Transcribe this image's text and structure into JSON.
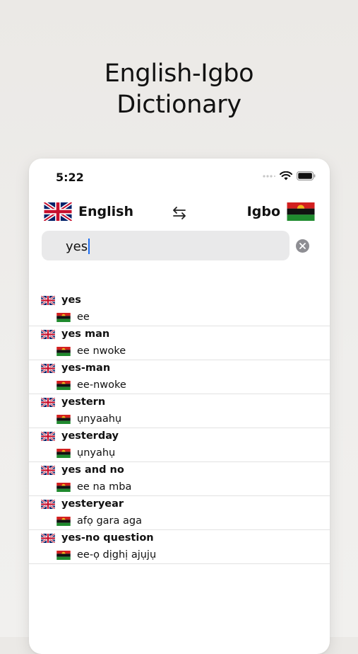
{
  "headline": {
    "line1": "English-Igbo",
    "line2": "Dictionary"
  },
  "status_bar": {
    "time": "5:22"
  },
  "languages": {
    "source": "English",
    "target": "Igbo"
  },
  "icons": {
    "swap": "swap-arrows-icon",
    "clear": "clear-circle-icon",
    "wifi": "wifi-icon",
    "battery": "battery-icon",
    "signal": "signal-dots-icon"
  },
  "search": {
    "value": "yes"
  },
  "colors": {
    "accent_caret": "#1a6cf0",
    "biafra_red": "#d21f1f",
    "biafra_black": "#111111",
    "biafra_green": "#1f8a2e",
    "biafra_sun": "#f1b51a"
  },
  "results": [
    {
      "en": "yes",
      "ig": "ee"
    },
    {
      "en": "yes man",
      "ig": "ee nwoke"
    },
    {
      "en": "yes-man",
      "ig": "ee-nwoke"
    },
    {
      "en": "yestern",
      "ig": "ụnyaahụ"
    },
    {
      "en": "yesterday",
      "ig": "ụnyahụ"
    },
    {
      "en": "yes and no",
      "ig": "ee na mba"
    },
    {
      "en": "yesteryear",
      "ig": "afọ gara aga"
    },
    {
      "en": "yes-no question",
      "ig": "ee-ọ dịghị ajụjụ"
    }
  ]
}
